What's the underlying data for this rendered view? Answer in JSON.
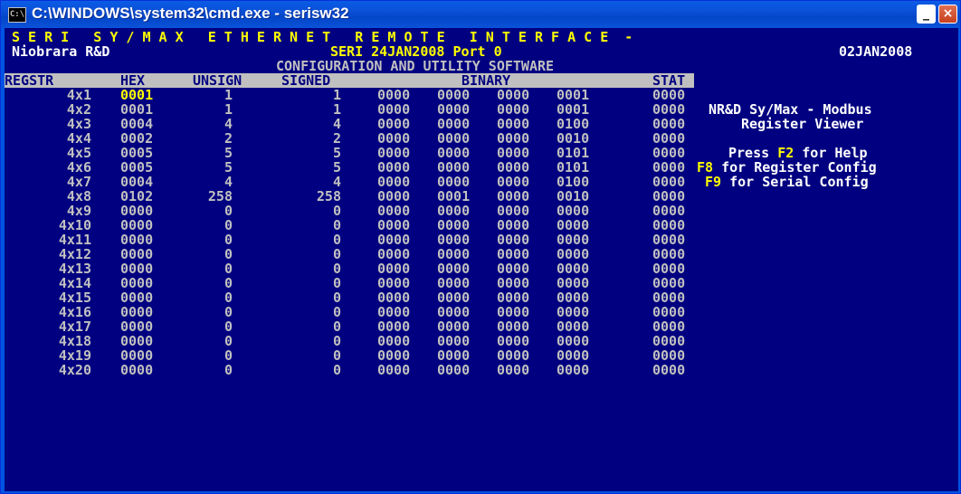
{
  "window": {
    "icon": "C:\\",
    "title": "C:\\WINDOWS\\system32\\cmd.exe - serisw32",
    "minimize_icon": "minimize-icon",
    "close_icon": "close-icon",
    "minimize_glyph": "_",
    "maximize_glyph": "□",
    "close_glyph": "×"
  },
  "header": {
    "banner": "S E R I   S Y / M A X   E T H E R N E T   R E M O T E   I N T E R F A C E  -",
    "left": "Niobrara R&D",
    "center": "SERI 24JAN2008 Port 0",
    "right": "02JAN2008",
    "subtitle": "CONFIGURATION AND UTILITY SOFTWARE"
  },
  "table": {
    "columns": [
      "REGSTR",
      "HEX",
      "UNSIGN",
      "SIGNED",
      "BINARY",
      "STAT"
    ],
    "rows": [
      {
        "reg": "4x1",
        "hex": "0001",
        "unsign": "1",
        "signed": "1",
        "b1": "0000",
        "b2": "0000",
        "b3": "0000",
        "b4": "0001",
        "stat": "0000"
      },
      {
        "reg": "4x2",
        "hex": "0001",
        "unsign": "1",
        "signed": "1",
        "b1": "0000",
        "b2": "0000",
        "b3": "0000",
        "b4": "0001",
        "stat": "0000"
      },
      {
        "reg": "4x3",
        "hex": "0004",
        "unsign": "4",
        "signed": "4",
        "b1": "0000",
        "b2": "0000",
        "b3": "0000",
        "b4": "0100",
        "stat": "0000"
      },
      {
        "reg": "4x4",
        "hex": "0002",
        "unsign": "2",
        "signed": "2",
        "b1": "0000",
        "b2": "0000",
        "b3": "0000",
        "b4": "0010",
        "stat": "0000"
      },
      {
        "reg": "4x5",
        "hex": "0005",
        "unsign": "5",
        "signed": "5",
        "b1": "0000",
        "b2": "0000",
        "b3": "0000",
        "b4": "0101",
        "stat": "0000"
      },
      {
        "reg": "4x6",
        "hex": "0005",
        "unsign": "5",
        "signed": "5",
        "b1": "0000",
        "b2": "0000",
        "b3": "0000",
        "b4": "0101",
        "stat": "0000"
      },
      {
        "reg": "4x7",
        "hex": "0004",
        "unsign": "4",
        "signed": "4",
        "b1": "0000",
        "b2": "0000",
        "b3": "0000",
        "b4": "0100",
        "stat": "0000"
      },
      {
        "reg": "4x8",
        "hex": "0102",
        "unsign": "258",
        "signed": "258",
        "b1": "0000",
        "b2": "0001",
        "b3": "0000",
        "b4": "0010",
        "stat": "0000"
      },
      {
        "reg": "4x9",
        "hex": "0000",
        "unsign": "0",
        "signed": "0",
        "b1": "0000",
        "b2": "0000",
        "b3": "0000",
        "b4": "0000",
        "stat": "0000"
      },
      {
        "reg": "4x10",
        "hex": "0000",
        "unsign": "0",
        "signed": "0",
        "b1": "0000",
        "b2": "0000",
        "b3": "0000",
        "b4": "0000",
        "stat": "0000"
      },
      {
        "reg": "4x11",
        "hex": "0000",
        "unsign": "0",
        "signed": "0",
        "b1": "0000",
        "b2": "0000",
        "b3": "0000",
        "b4": "0000",
        "stat": "0000"
      },
      {
        "reg": "4x12",
        "hex": "0000",
        "unsign": "0",
        "signed": "0",
        "b1": "0000",
        "b2": "0000",
        "b3": "0000",
        "b4": "0000",
        "stat": "0000"
      },
      {
        "reg": "4x13",
        "hex": "0000",
        "unsign": "0",
        "signed": "0",
        "b1": "0000",
        "b2": "0000",
        "b3": "0000",
        "b4": "0000",
        "stat": "0000"
      },
      {
        "reg": "4x14",
        "hex": "0000",
        "unsign": "0",
        "signed": "0",
        "b1": "0000",
        "b2": "0000",
        "b3": "0000",
        "b4": "0000",
        "stat": "0000"
      },
      {
        "reg": "4x15",
        "hex": "0000",
        "unsign": "0",
        "signed": "0",
        "b1": "0000",
        "b2": "0000",
        "b3": "0000",
        "b4": "0000",
        "stat": "0000"
      },
      {
        "reg": "4x16",
        "hex": "0000",
        "unsign": "0",
        "signed": "0",
        "b1": "0000",
        "b2": "0000",
        "b3": "0000",
        "b4": "0000",
        "stat": "0000"
      },
      {
        "reg": "4x17",
        "hex": "0000",
        "unsign": "0",
        "signed": "0",
        "b1": "0000",
        "b2": "0000",
        "b3": "0000",
        "b4": "0000",
        "stat": "0000"
      },
      {
        "reg": "4x18",
        "hex": "0000",
        "unsign": "0",
        "signed": "0",
        "b1": "0000",
        "b2": "0000",
        "b3": "0000",
        "b4": "0000",
        "stat": "0000"
      },
      {
        "reg": "4x19",
        "hex": "0000",
        "unsign": "0",
        "signed": "0",
        "b1": "0000",
        "b2": "0000",
        "b3": "0000",
        "b4": "0000",
        "stat": "0000"
      },
      {
        "reg": "4x20",
        "hex": "0000",
        "unsign": "0",
        "signed": "0",
        "b1": "0000",
        "b2": "0000",
        "b3": "0000",
        "b4": "0000",
        "stat": "0000"
      }
    ]
  },
  "side": {
    "line1": "NR&D Sy/Max - Modbus",
    "line2": "Register Viewer",
    "help_prefix": "Press ",
    "help_key": "F2",
    "help_suffix": " for Help",
    "f8_key": "F8",
    "f8_text": " for Register Config",
    "f9_key": "F9",
    "f9_text": " for Serial Config"
  },
  "colors": {
    "console_bg": "#000080",
    "text": "#c0c0c0",
    "highlight": "#ffff00",
    "header_bar": "#c0c0c0"
  }
}
